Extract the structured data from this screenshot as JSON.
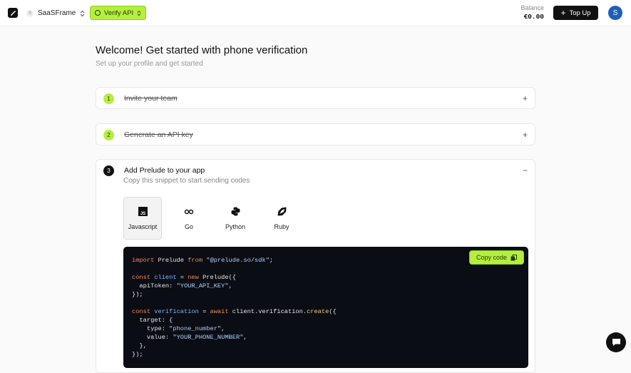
{
  "header": {
    "workspace_initial": "S",
    "workspace_name": "SaaSFrame",
    "verify_label": "Verify API",
    "balance_label": "Balance",
    "balance_value": "€0.00",
    "topup_label": "Top Up",
    "user_initial": "S"
  },
  "page": {
    "title": "Welcome! Get started with phone verification",
    "subtitle": "Set up your profile and get started"
  },
  "steps": [
    {
      "num": "1",
      "title": "Invite your team",
      "done": true,
      "toggle": "+"
    },
    {
      "num": "2",
      "title": "Generate an API key",
      "done": true,
      "toggle": "+"
    },
    {
      "num": "3",
      "title": "Add Prelude to your app",
      "done": false,
      "toggle": "−",
      "desc": "Copy this snippet to start sending codes"
    }
  ],
  "languages": [
    {
      "label": "Javascript",
      "icon": "javascript-icon",
      "selected": true
    },
    {
      "label": "Go",
      "icon": "go-icon",
      "selected": false
    },
    {
      "label": "Python",
      "icon": "python-icon",
      "selected": false
    },
    {
      "label": "Ruby",
      "icon": "ruby-icon",
      "selected": false
    }
  ],
  "code": {
    "copy_label": "Copy code",
    "lines": [
      [
        "kw:import",
        " Prelude ",
        "kw:from",
        " ",
        "str:\"@prelude.so/sdk\"",
        ";"
      ],
      [],
      [
        "kw:const",
        " ",
        "vr:client",
        " = ",
        "kw:new",
        " Prelude({"
      ],
      [
        "  apiToken: ",
        "str:\"YOUR_API_KEY\"",
        ","
      ],
      [
        "});"
      ],
      [],
      [
        "kw:const",
        " ",
        "vr:verification",
        " = ",
        "kw:await",
        " client.verification.",
        "fn:create",
        "({"
      ],
      [
        "  target: {"
      ],
      [
        "    type: ",
        "str:\"phone_number\"",
        ","
      ],
      [
        "    value: ",
        "str:\"YOUR_PHONE_NUMBER\"",
        ","
      ],
      [
        "  },"
      ],
      [
        "});"
      ]
    ]
  }
}
